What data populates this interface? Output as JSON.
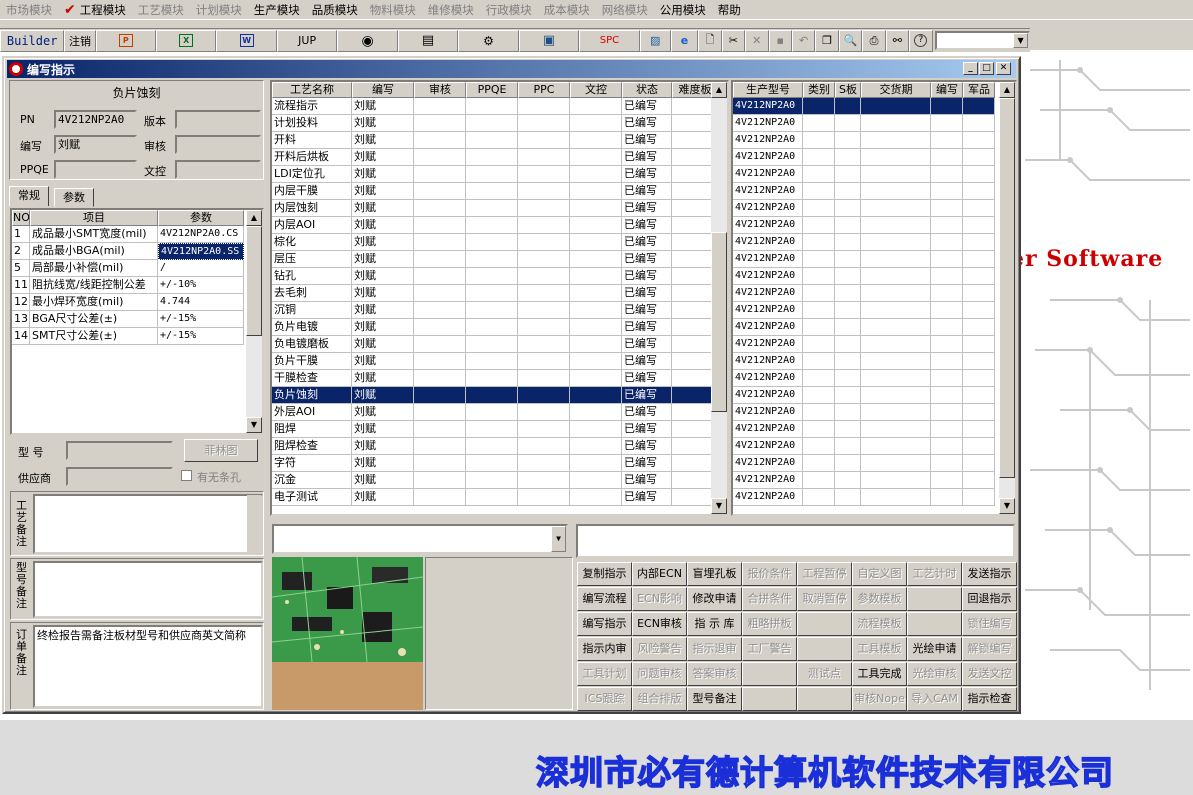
{
  "menu": [
    {
      "label": "市场模块",
      "active": false
    },
    {
      "label": "工程模块",
      "active": true
    },
    {
      "label": "工艺模块",
      "active": false
    },
    {
      "label": "计划模块",
      "active": false
    },
    {
      "label": "生产模块",
      "active": true
    },
    {
      "label": "品质模块",
      "active": true
    },
    {
      "label": "物料模块",
      "active": false
    },
    {
      "label": "维修模块",
      "active": false
    },
    {
      "label": "行政模块",
      "active": false
    },
    {
      "label": "成本模块",
      "active": false
    },
    {
      "label": "网络模块",
      "active": false
    },
    {
      "label": "公用模块",
      "active": true
    },
    {
      "label": "帮助",
      "active": true
    }
  ],
  "toolbar": {
    "builder": "Builder",
    "logout": "注销",
    "jup": "JUP",
    "spc": "SPC"
  },
  "window": {
    "title": "编写指示"
  },
  "left": {
    "header": "负片蚀刻",
    "pn_label": "PN",
    "pn_value": "4V212NP2A0",
    "version_label": "版本",
    "version_value": "",
    "author_label": "编写",
    "author_value": "刘赋",
    "review_label": "审核",
    "review_value": "",
    "ppqe_label": "PPQE",
    "ppqe_value": "",
    "doc_label": "文控",
    "doc_value": "",
    "tabs": [
      "常规",
      "参数"
    ],
    "params_headers": [
      "NO",
      "项目",
      "参数"
    ],
    "params": [
      {
        "no": "1",
        "item": "成品最小SMT宽度(mil)",
        "value": "4V212NP2A0.CS"
      },
      {
        "no": "2",
        "item": "成品最小BGA(mil)",
        "value": "4V212NP2A0.SS"
      },
      {
        "no": "5",
        "item": "局部最小补偿(mil)",
        "value": "/"
      },
      {
        "no": "11",
        "item": "阻抗线宽/线距控制公差",
        "value": "+/-10%"
      },
      {
        "no": "12",
        "item": "最小焊环宽度(mil)",
        "value": "4.744"
      },
      {
        "no": "13",
        "item": "BGA尺寸公差(±)",
        "value": "+/-15%"
      },
      {
        "no": "14",
        "item": "SMT尺寸公差(±)",
        "value": "+/-15%"
      }
    ],
    "model_label": "型 号",
    "model_value": "",
    "film_button": "菲林图",
    "supplier_label": "供应商",
    "supplier_value": "",
    "notch_label": "有无条孔",
    "process_note_label": "工艺备注",
    "process_note": "",
    "model_note_label": "型号备注",
    "model_note": "",
    "order_note_label": "订单备注",
    "order_note": "终检报告需备注板材型号和供应商英文简称"
  },
  "process": {
    "headers": [
      "工艺名称",
      "编写",
      "审核",
      "PPQE",
      "PPC",
      "文控",
      "状态",
      "难度板"
    ],
    "rows": [
      {
        "name": "流程指示",
        "author": "刘赋",
        "status": "已编写"
      },
      {
        "name": "计划投料",
        "author": "刘赋",
        "status": "已编写"
      },
      {
        "name": "开料",
        "author": "刘赋",
        "status": "已编写"
      },
      {
        "name": "开料后烘板",
        "author": "刘赋",
        "status": "已编写"
      },
      {
        "name": "LDI定位孔",
        "author": "刘赋",
        "status": "已编写"
      },
      {
        "name": "内层干膜",
        "author": "刘赋",
        "status": "已编写"
      },
      {
        "name": "内层蚀刻",
        "author": "刘赋",
        "status": "已编写"
      },
      {
        "name": "内层AOI",
        "author": "刘赋",
        "status": "已编写"
      },
      {
        "name": "棕化",
        "author": "刘赋",
        "status": "已编写"
      },
      {
        "name": "层压",
        "author": "刘赋",
        "status": "已编写"
      },
      {
        "name": "钻孔",
        "author": "刘赋",
        "status": "已编写"
      },
      {
        "name": "去毛刺",
        "author": "刘赋",
        "status": "已编写"
      },
      {
        "name": "沉铜",
        "author": "刘赋",
        "status": "已编写"
      },
      {
        "name": "负片电镀",
        "author": "刘赋",
        "status": "已编写"
      },
      {
        "name": "负电镀磨板",
        "author": "刘赋",
        "status": "已编写"
      },
      {
        "name": "负片干膜",
        "author": "刘赋",
        "status": "已编写"
      },
      {
        "name": "干膜检查",
        "author": "刘赋",
        "status": "已编写"
      },
      {
        "name": "负片蚀刻",
        "author": "刘赋",
        "status": "已编写",
        "selected": true
      },
      {
        "name": "外层AOI",
        "author": "刘赋",
        "status": "已编写"
      },
      {
        "name": "阻焊",
        "author": "刘赋",
        "status": "已编写"
      },
      {
        "name": "阻焊检查",
        "author": "刘赋",
        "status": "已编写"
      },
      {
        "name": "字符",
        "author": "刘赋",
        "status": "已编写"
      },
      {
        "name": "沉金",
        "author": "刘赋",
        "status": "已编写"
      },
      {
        "name": "电子测试",
        "author": "刘赋",
        "status": "已编写"
      }
    ]
  },
  "production": {
    "headers": [
      "生产型号",
      "类别",
      "S板",
      "交货期",
      "编写",
      "军品"
    ],
    "rows": [
      "4V212NP2A0",
      "4V212NP2A0",
      "4V212NP2A0",
      "4V212NP2A0",
      "4V212NP2A0",
      "4V212NP2A0",
      "4V212NP2A0",
      "4V212NP2A0",
      "4V212NP2A0",
      "4V212NP2A0",
      "4V212NP2A0",
      "4V212NP2A0",
      "4V212NP2A0",
      "4V212NP2A0",
      "4V212NP2A0",
      "4V212NP2A0",
      "4V212NP2A0",
      "4V212NP2A0",
      "4V212NP2A0",
      "4V212NP2A0",
      "4V212NP2A0",
      "4V212NP2A0",
      "4V212NP2A0",
      "4V212NP2A0"
    ]
  },
  "buttons": [
    [
      {
        "label": "复制指示",
        "enabled": true
      },
      {
        "label": "内部ECN",
        "enabled": true
      },
      {
        "label": "盲埋孔板",
        "enabled": true
      },
      {
        "label": "报价条件",
        "enabled": false
      },
      {
        "label": "工程暂停",
        "enabled": false
      },
      {
        "label": "自定义图",
        "enabled": false
      },
      {
        "label": "工艺计时",
        "enabled": false
      },
      {
        "label": "发送指示",
        "enabled": true
      }
    ],
    [
      {
        "label": "编写流程",
        "enabled": true
      },
      {
        "label": "ECN影响",
        "enabled": false
      },
      {
        "label": "修改申请",
        "enabled": true
      },
      {
        "label": "合拼条件",
        "enabled": false
      },
      {
        "label": "取消暂停",
        "enabled": false
      },
      {
        "label": "参数模板",
        "enabled": false
      },
      {
        "label": "",
        "enabled": false
      },
      {
        "label": "回退指示",
        "enabled": true
      }
    ],
    [
      {
        "label": "编写指示",
        "enabled": true
      },
      {
        "label": "ECN审核",
        "enabled": true
      },
      {
        "label": "指 示 库",
        "enabled": true
      },
      {
        "label": "粗略拼板",
        "enabled": false
      },
      {
        "label": "",
        "enabled": false
      },
      {
        "label": "流程模板",
        "enabled": false
      },
      {
        "label": "",
        "enabled": false
      },
      {
        "label": "锁住编写",
        "enabled": false
      }
    ],
    [
      {
        "label": "指示内审",
        "enabled": true
      },
      {
        "label": "风险警告",
        "enabled": false
      },
      {
        "label": "指示退审",
        "enabled": false
      },
      {
        "label": "工厂警告",
        "enabled": false
      },
      {
        "label": "",
        "enabled": false
      },
      {
        "label": "工具模板",
        "enabled": false
      },
      {
        "label": "光绘申请",
        "enabled": true
      },
      {
        "label": "解锁编写",
        "enabled": false
      }
    ],
    [
      {
        "label": "工具计划",
        "enabled": false
      },
      {
        "label": "问题审核",
        "enabled": false
      },
      {
        "label": "答案审核",
        "enabled": false
      },
      {
        "label": "",
        "enabled": false
      },
      {
        "label": "测试点",
        "enabled": false
      },
      {
        "label": "工具完成",
        "enabled": true
      },
      {
        "label": "光绘审核",
        "enabled": false
      },
      {
        "label": "发送文控",
        "enabled": false
      }
    ],
    [
      {
        "label": "ICS跟踪",
        "enabled": false
      },
      {
        "label": "组合排版",
        "enabled": false
      },
      {
        "label": "型号备注",
        "enabled": true
      },
      {
        "label": "",
        "enabled": false
      },
      {
        "label": "",
        "enabled": false
      },
      {
        "label": "审核Nope",
        "enabled": false
      },
      {
        "label": "导入CAM",
        "enabled": false
      },
      {
        "label": "指示检查",
        "enabled": true
      }
    ]
  ],
  "desktop": {
    "banner": "er Software",
    "company": "深圳市必有德计算机软件技术有限公司"
  }
}
